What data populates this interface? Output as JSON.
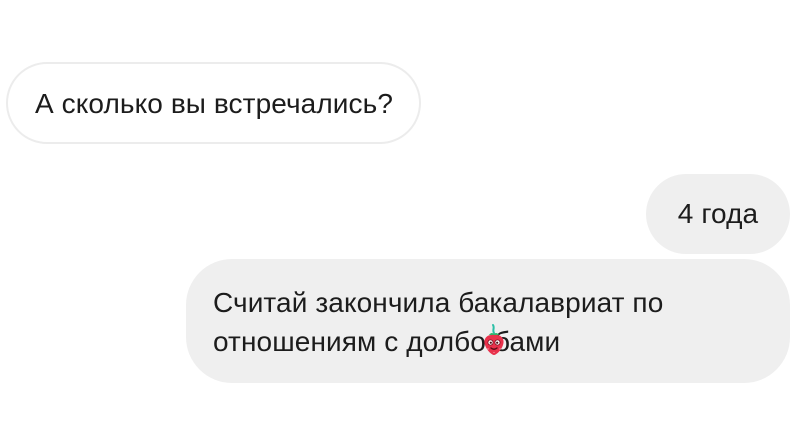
{
  "messages": [
    {
      "side": "incoming",
      "text": "А сколько вы встречались?"
    },
    {
      "side": "outgoing",
      "text": "4 года"
    },
    {
      "side": "outgoing",
      "line1": "Считай закончила бакалавриат по",
      "line2_before": "отношениям с долбо",
      "line2_after": "бами",
      "emoji": "strawberry-emoji-icon"
    }
  ],
  "colors": {
    "incoming_bubble": "#ffffff",
    "incoming_border": "#ececec",
    "outgoing_bubble": "#efefef",
    "text": "#1c1c1c"
  }
}
